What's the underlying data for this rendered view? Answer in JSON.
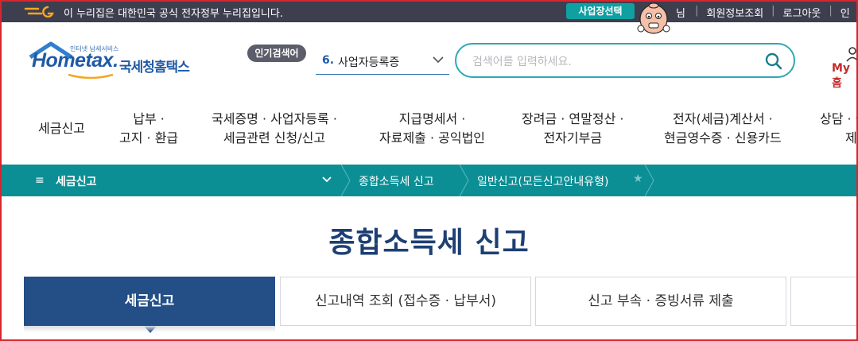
{
  "govbar": {
    "text": "이 누리집은 대한민국 공식 전자정부 누리집입니다.",
    "business_select": "사업장선택",
    "user_suffix": "님",
    "links": [
      "회원정보조회",
      "로그아웃",
      "인"
    ]
  },
  "logo": {
    "small_text": "인터넷 납세서비스",
    "main_text": "Hometax.",
    "kr_text": "국세청홈택스"
  },
  "popular": {
    "badge": "인기검색어",
    "rank": "6.",
    "term": "사업자등록증"
  },
  "search": {
    "placeholder": "검색어를 입력하세요."
  },
  "myhome": "My홈",
  "menu": [
    {
      "lines": [
        "세금신고"
      ]
    },
    {
      "lines": [
        "납부 ·",
        "고지 · 환급"
      ]
    },
    {
      "lines": [
        "국세증명 · 사업자등록 ·",
        "세금관련 신청/신고"
      ]
    },
    {
      "lines": [
        "지급명세서 ·",
        "자료제출 · 공익법인"
      ]
    },
    {
      "lines": [
        "장려금 · 연말정산 ·",
        "전자기부금"
      ]
    },
    {
      "lines": [
        "전자(세금)계산서 ·",
        "현금영수증 · 신용카드"
      ]
    },
    {
      "lines": [
        "상담 · 불",
        "제"
      ]
    }
  ],
  "breadcrumb": {
    "section": "세금신고",
    "items": [
      "종합소득세 신고",
      "일반신고(모든신고안내유형)"
    ]
  },
  "page_title": "종합소득세 신고",
  "tabs": [
    {
      "label": "세금신고",
      "active": true
    },
    {
      "label": "신고내역 조회 (접수증 · 납부서)",
      "active": false
    },
    {
      "label": "신고 부속 · 증빙서류 제출",
      "active": false
    },
    {
      "label": "",
      "active": false
    }
  ],
  "colors": {
    "govbar": "#3d3f4f",
    "teal": "#0b8f95",
    "navy": "#244e86",
    "title": "#1d3f73",
    "frame": "#d6262f"
  }
}
